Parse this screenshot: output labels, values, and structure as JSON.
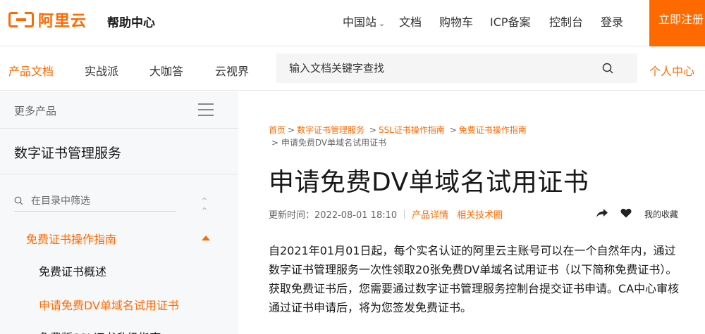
{
  "header": {
    "logo_text": "阿里云",
    "help_title": "帮助中心",
    "nav": {
      "china_site": "中国站",
      "docs": "文档",
      "cart": "购物车",
      "icp": "ICP备案",
      "console": "控制台",
      "login": "登录"
    },
    "register_label": "立即注册"
  },
  "subnav": {
    "items": [
      "产品文档",
      "实战派",
      "大咖答",
      "云视界"
    ],
    "active_index": 0,
    "search_placeholder": "输入文档关键字查找",
    "personal_center": "个人中心"
  },
  "sidebar": {
    "more_products": "更多产品",
    "service_title": "数字证书管理服务",
    "filter_placeholder": "在目录中筛选",
    "tree": {
      "parent": "免费证书操作指南",
      "items": [
        "免费证书概述",
        "申请免费DV单域名试用证书",
        "免费版SSL证书升级指南"
      ],
      "active_index": 1
    }
  },
  "breadcrumb": {
    "items": [
      "首页",
      "数字证书管理服务",
      "SSL证书操作指南",
      "免费证书操作指南"
    ],
    "current": "申请免费DV单域名试用证书"
  },
  "article": {
    "title": "申请免费DV单域名试用证书",
    "updated": "更新时间：2022-08-01 18:10",
    "product_details": "产品详情",
    "related_circle": "相关技术圈",
    "favorite": "我的收藏",
    "body": "自2021年01月01日起，每个实名认证的阿里云主账号可以在一个自然年内，通过数字证书管理服务一次性领取20张免费DV单域名试用证书（以下简称免费证书）。获取免费证书后，您需要通过数字证书管理服务控制台提交证书申请。CA中心审核通过证书申请后，将为您签发免费证书。"
  },
  "colors": {
    "brand": "#ff6a00",
    "text": "#181818",
    "sidebar_bg": "#f7f8fa"
  }
}
